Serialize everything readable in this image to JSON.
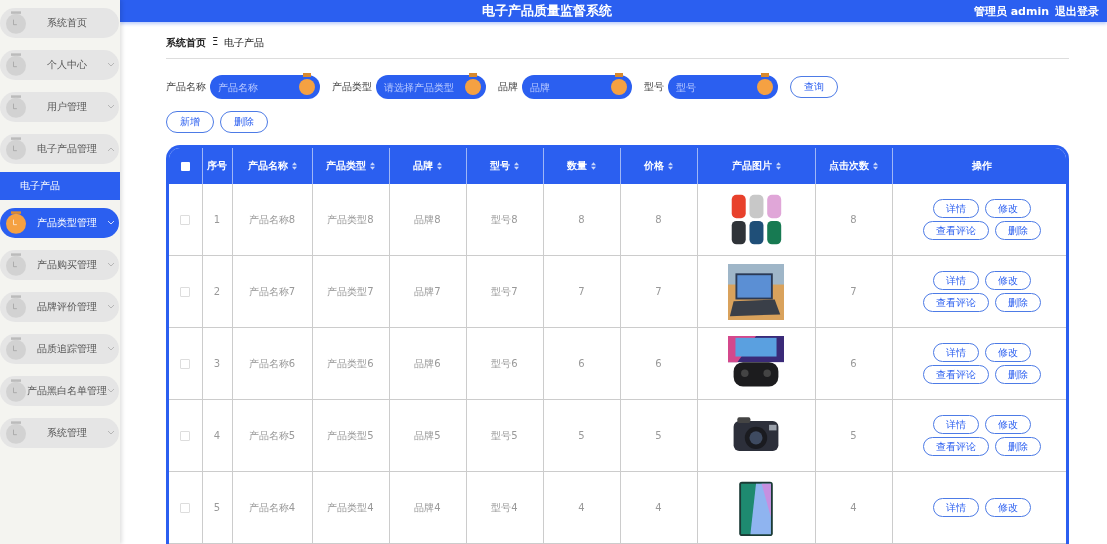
{
  "header": {
    "title": "电子产品质量监督系统",
    "user": "管理员 admin",
    "logout": "退出登录"
  },
  "sidebar": {
    "items": [
      {
        "label": "系统首页",
        "expandable": false,
        "highlighted": false
      },
      {
        "label": "个人中心",
        "expandable": true,
        "expanded": false,
        "highlighted": false
      },
      {
        "label": "用户管理",
        "expandable": true,
        "expanded": false,
        "highlighted": false
      },
      {
        "label": "电子产品管理",
        "expandable": true,
        "expanded": true,
        "highlighted": false,
        "children": [
          {
            "label": "电子产品",
            "selected": true
          }
        ]
      },
      {
        "label": "产品类型管理",
        "expandable": true,
        "expanded": false,
        "highlighted": true
      },
      {
        "label": "产品购买管理",
        "expandable": true,
        "expanded": false,
        "highlighted": false
      },
      {
        "label": "品牌评价管理",
        "expandable": true,
        "expanded": false,
        "highlighted": false
      },
      {
        "label": "品质追踪管理",
        "expandable": true,
        "expanded": false,
        "highlighted": false
      },
      {
        "label": "产品黑白名单管理",
        "expandable": true,
        "expanded": false,
        "highlighted": false
      },
      {
        "label": "系统管理",
        "expandable": true,
        "expanded": false,
        "highlighted": false
      }
    ]
  },
  "breadcrumb": {
    "home": "系统首页",
    "separator": "Ξ",
    "current": "电子产品"
  },
  "search": {
    "fields": [
      {
        "label": "产品名称",
        "placeholder": "产品名称"
      },
      {
        "label": "产品类型",
        "placeholder": "请选择产品类型"
      },
      {
        "label": "品牌",
        "placeholder": "品牌"
      },
      {
        "label": "型号",
        "placeholder": "型号"
      }
    ],
    "button": "查询"
  },
  "actions": [
    "新增",
    "删除"
  ],
  "table": {
    "select_all_checked": false,
    "columns": [
      {
        "label": "序号",
        "sortable": false
      },
      {
        "label": "产品名称",
        "sortable": true
      },
      {
        "label": "产品类型",
        "sortable": true
      },
      {
        "label": "品牌",
        "sortable": true
      },
      {
        "label": "型号",
        "sortable": true
      },
      {
        "label": "数量",
        "sortable": true
      },
      {
        "label": "价格",
        "sortable": true
      },
      {
        "label": "产品图片",
        "sortable": true
      },
      {
        "label": "点击次数",
        "sortable": true
      },
      {
        "label": "操作",
        "sortable": false
      }
    ],
    "rows": [
      {
        "checked": false,
        "cells": [
          "1",
          "产品名称8",
          "产品类型8",
          "品牌8",
          "型号8",
          "8",
          "8"
        ],
        "clicks": "8",
        "buttons": [
          "详情",
          "修改",
          "查看评论",
          "删除"
        ]
      },
      {
        "checked": false,
        "cells": [
          "2",
          "产品名称7",
          "产品类型7",
          "品牌7",
          "型号7",
          "7",
          "7"
        ],
        "clicks": "7",
        "buttons": [
          "详情",
          "修改",
          "查看评论",
          "删除"
        ]
      },
      {
        "checked": false,
        "cells": [
          "3",
          "产品名称6",
          "产品类型6",
          "品牌6",
          "型号6",
          "6",
          "6"
        ],
        "clicks": "6",
        "buttons": [
          "详情",
          "修改",
          "查看评论",
          "删除"
        ]
      },
      {
        "checked": false,
        "cells": [
          "4",
          "产品名称5",
          "产品类型5",
          "品牌5",
          "型号5",
          "5",
          "5"
        ],
        "clicks": "5",
        "buttons": [
          "详情",
          "修改",
          "查看评论",
          "删除"
        ]
      },
      {
        "checked": false,
        "cells": [
          "5",
          "产品名称4",
          "产品类型4",
          "品牌4",
          "型号4",
          "4",
          "4"
        ],
        "clicks": "4",
        "buttons": [
          "详情",
          "修改"
        ]
      }
    ]
  }
}
